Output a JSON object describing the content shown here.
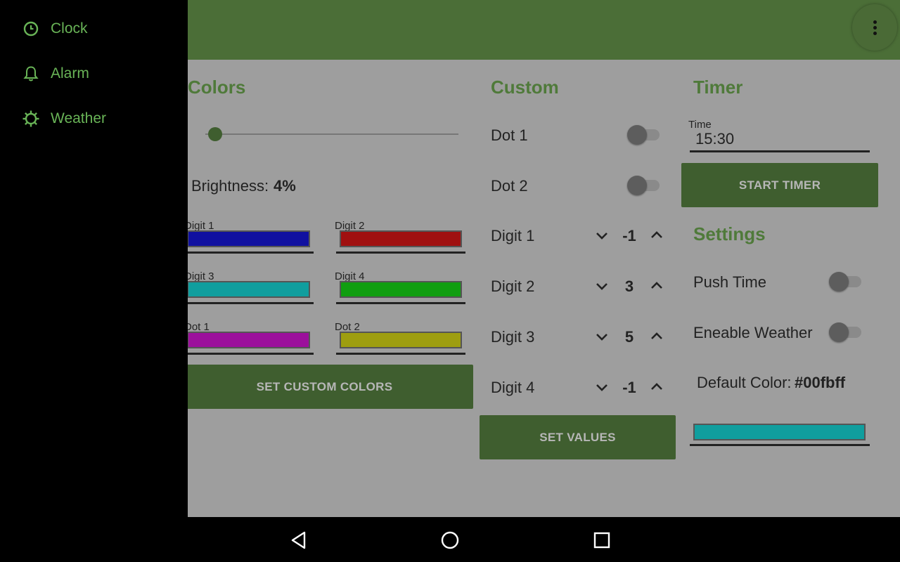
{
  "colors_section": {
    "title": "Colors",
    "brightness_label": "Brightness:",
    "brightness_value": "4%",
    "slider_fraction": 0.04,
    "digits": [
      {
        "label": "Digit 1",
        "color": "#1010a0"
      },
      {
        "label": "Digit 2",
        "color": "#a01010"
      },
      {
        "label": "Digit 3",
        "color": "#109e9e"
      },
      {
        "label": "Digit 4",
        "color": "#109e10"
      },
      {
        "label": "Dot 1",
        "color": "#9c109c"
      },
      {
        "label": "Dot 2",
        "color": "#9e9e10"
      }
    ],
    "set_button": "SET CUSTOM COLORS"
  },
  "custom_section": {
    "title": "Custom",
    "dots": [
      {
        "label": "Dot 1",
        "on": false
      },
      {
        "label": "Dot 2",
        "on": false
      }
    ],
    "digits": [
      {
        "label": "Digit 1",
        "value": "-1"
      },
      {
        "label": "Digit 2",
        "value": "3"
      },
      {
        "label": "Digit 3",
        "value": "5"
      },
      {
        "label": "Digit 4",
        "value": "-1"
      }
    ],
    "set_button": "SET VALUES"
  },
  "timer_section": {
    "title": "Timer",
    "time_label": "Time",
    "time_value": "15:30",
    "start_button": "START TIMER"
  },
  "settings_section": {
    "title": "Settings",
    "push_time_label": "Push Time",
    "weather_label": "Eneable Weather",
    "default_color_label": "Default Color:",
    "default_color_value": "#00fbff",
    "default_color_swatch": "#109e9e"
  },
  "drawer": {
    "items": [
      {
        "label": "Clock",
        "icon": "clock-icon"
      },
      {
        "label": "Alarm",
        "icon": "bell-icon"
      },
      {
        "label": "Weather",
        "icon": "sun-icon"
      }
    ]
  },
  "navbar": {
    "icons": [
      "back-icon",
      "home-icon",
      "recents-icon"
    ]
  },
  "theme": {
    "accent": "#4b6e37",
    "drawer_text": "#69b457",
    "button": "#3f5e2f"
  }
}
